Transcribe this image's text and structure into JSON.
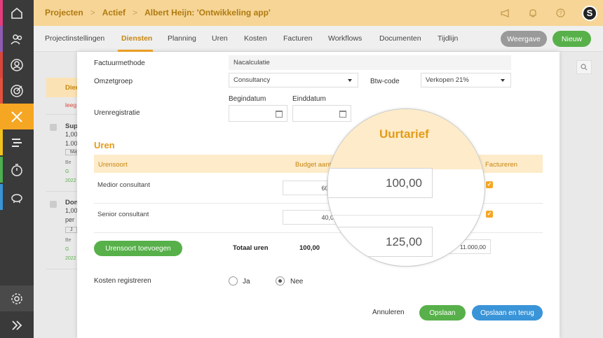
{
  "sidebar": {
    "items": [
      {
        "icon": "home-icon",
        "stripe": "#e33d7f"
      },
      {
        "icon": "people-icon",
        "stripe": "#8e5bb5"
      },
      {
        "icon": "user-icon",
        "stripe": "#d8463b"
      },
      {
        "icon": "target-icon",
        "stripe": "#e3503e"
      },
      {
        "icon": "tools-icon",
        "stripe": "#f5a623",
        "active": true
      },
      {
        "icon": "timeline-icon",
        "stripe": "#f3c11c"
      },
      {
        "icon": "stopwatch-icon",
        "stripe": "#4caf50"
      },
      {
        "icon": "piggy-bank-icon",
        "stripe": "#3a94d8"
      },
      {
        "icon": "settings-icon",
        "stripe": ""
      },
      {
        "icon": "expand-icon",
        "stripe": ""
      }
    ]
  },
  "header": {
    "breadcrumbs": [
      "Projecten",
      "Actief",
      "Albert Heijn: 'Ontwikkeling app'"
    ],
    "icons": [
      "megaphone-icon",
      "bell-icon",
      "help-icon"
    ],
    "logo": "S"
  },
  "tabs": {
    "items": [
      "Projectinstellingen",
      "Diensten",
      "Planning",
      "Uren",
      "Kosten",
      "Facturen",
      "Workflows",
      "Documenten",
      "Tijdlijn"
    ],
    "active": "Diensten",
    "view_button": "Weergave",
    "new_button": "Nieuw"
  },
  "background_list": {
    "items": [
      {
        "title": "Dien",
        "sub": "leeg"
      },
      {
        "title": "Sup",
        "lines": [
          "1,00",
          "1.00"
        ],
        "tag": "Ma"
      },
      {
        "title": "Don",
        "lines": [
          "1,00",
          "per"
        ],
        "tag": "J"
      }
    ],
    "side_marks": [
      "Be",
      "G",
      "2022",
      "Be",
      "G",
      "2022"
    ]
  },
  "form": {
    "factuurmethode_label": "Factuurmethode",
    "factuurmethode_value": "Nacalculatie",
    "omzetgroep_label": "Omzetgroep",
    "omzetgroep_value": "Consultancy",
    "btw_label": "Btw-code",
    "btw_value": "Verkopen 21%",
    "begindatum_label": "Begindatum",
    "einddatum_label": "Einddatum",
    "urenregistratie_label": "Urenregistratie",
    "begindatum_value": "",
    "einddatum_value": ""
  },
  "uren": {
    "title": "Uren",
    "columns": {
      "urensoort": "Urensoort",
      "budget": "Budget aant",
      "totaal": "taal",
      "factureren": "Factureren"
    },
    "rows": [
      {
        "urensoort": "Medior consultant",
        "budget": "60,0",
        "uurtarief": "100,00",
        "totaal": "00",
        "factureren": true
      },
      {
        "urensoort": "Senior consultant",
        "budget": "40,0",
        "uurtarief": "125,00",
        "totaal": "00",
        "factureren": true
      }
    ],
    "add_button": "Urensoort toevoegen",
    "total_label": "Totaal uren",
    "total_hours": "100,00",
    "total_amount": "11.000,00"
  },
  "kosten": {
    "label": "Kosten registreren",
    "options": [
      "Ja",
      "Nee"
    ],
    "selected": "Nee"
  },
  "footer": {
    "cancel": "Annuleren",
    "save": "Opslaan",
    "save_back": "Opslaan en terug"
  },
  "magnifier": {
    "title": "Uurtarief",
    "values": [
      "100,00",
      "125,00"
    ]
  },
  "colors": {
    "accent": "#f5a623",
    "header_bg": "#f6d596",
    "green": "#57b049",
    "blue": "#3a94d8"
  }
}
